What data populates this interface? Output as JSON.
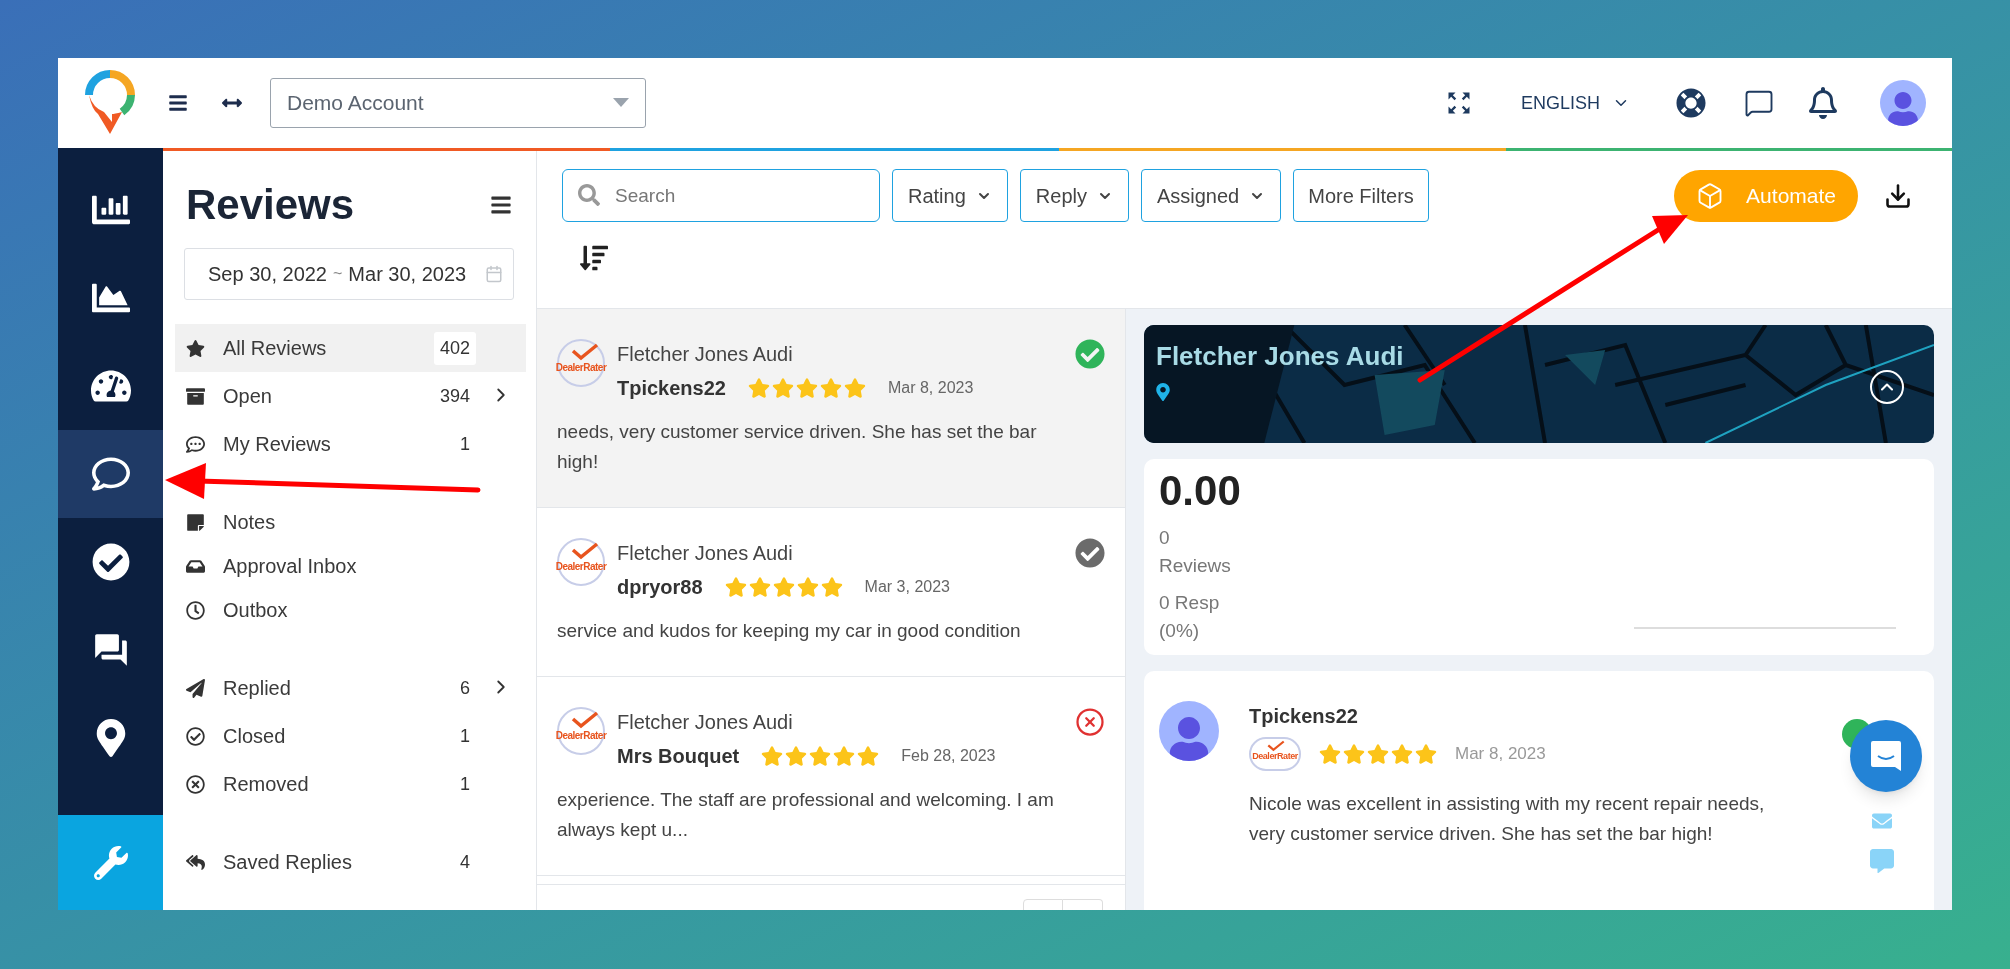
{
  "header": {
    "account": "Demo Account",
    "language": "ENGLISH"
  },
  "rail": [
    {
      "kind": "bar-chart",
      "selected": false
    },
    {
      "kind": "area-chart",
      "selected": false
    },
    {
      "kind": "gauge",
      "selected": false
    },
    {
      "kind": "chat",
      "selected": true
    },
    {
      "kind": "check",
      "selected": false
    },
    {
      "kind": "qa",
      "selected": false
    },
    {
      "kind": "pin",
      "selected": false
    }
  ],
  "sidebar": {
    "title": "Reviews",
    "date_start": "Sep 30, 2022",
    "date_separator": "~",
    "date_end": "Mar 30, 2023",
    "groups": [
      [
        {
          "kind": "star",
          "label": "All Reviews",
          "count": "402",
          "selected": true,
          "submenu": false
        },
        {
          "kind": "archive",
          "label": "Open",
          "count": "394",
          "selected": false,
          "submenu": true
        },
        {
          "kind": "comment",
          "label": "My Reviews",
          "count": "1",
          "selected": false,
          "submenu": false
        }
      ],
      [
        {
          "kind": "note",
          "label": "Notes",
          "selected": false,
          "submenu": false
        },
        {
          "kind": "inbox",
          "label": "Approval Inbox",
          "selected": false,
          "submenu": false
        },
        {
          "kind": "clock",
          "label": "Outbox",
          "selected": false,
          "submenu": false
        }
      ],
      [
        {
          "kind": "send",
          "label": "Replied",
          "count": "6",
          "selected": false,
          "submenu": true
        },
        {
          "kind": "check",
          "label": "Closed",
          "count": "1",
          "selected": false,
          "submenu": false
        },
        {
          "kind": "remove",
          "label": "Removed",
          "count": "1",
          "selected": false,
          "submenu": false
        }
      ],
      [
        {
          "kind": "reply",
          "label": "Saved Replies",
          "count": "4",
          "selected": false,
          "submenu": false
        }
      ]
    ]
  },
  "filters": {
    "search_placeholder": "Search",
    "dropdowns": [
      "Rating",
      "Reply",
      "Assigned"
    ],
    "more": "More Filters",
    "automate": "Automate"
  },
  "reviews": [
    {
      "source": "DealerRater",
      "business": "Fletcher Jones Audi",
      "author": "Tpickens22",
      "stars": 5,
      "date": "Mar 8, 2023",
      "text": "needs, very customer service driven. She has set the bar high!",
      "kind": "approved",
      "selected": true
    },
    {
      "source": "DealerRater",
      "business": "Fletcher Jones Audi",
      "author": "dpryor88",
      "stars": 5,
      "date": "Mar 3, 2023",
      "text": "service and kudos for keeping my car in good condition",
      "kind": "done",
      "selected": false
    },
    {
      "source": "DealerRater",
      "business": "Fletcher Jones Audi",
      "author": "Mrs Bouquet",
      "stars": 5,
      "date": "Feb 28, 2023",
      "text": "experience. The staff are professional and welcoming. I am always kept u...",
      "kind": "rejected",
      "selected": false
    }
  ],
  "detail": {
    "business": "Fletcher Jones Audi",
    "rating": "0.00",
    "reviews_count": "0",
    "reviews_label": "Reviews",
    "responses": "0 Resp",
    "response_rate": "(0%)",
    "review": {
      "author": "Tpickens22",
      "source": "DealerRater",
      "stars": 5,
      "date": "Mar 8, 2023",
      "text": "Nicole was excellent in assisting with my recent repair needs, very customer service driven. She has set the bar high!"
    }
  }
}
